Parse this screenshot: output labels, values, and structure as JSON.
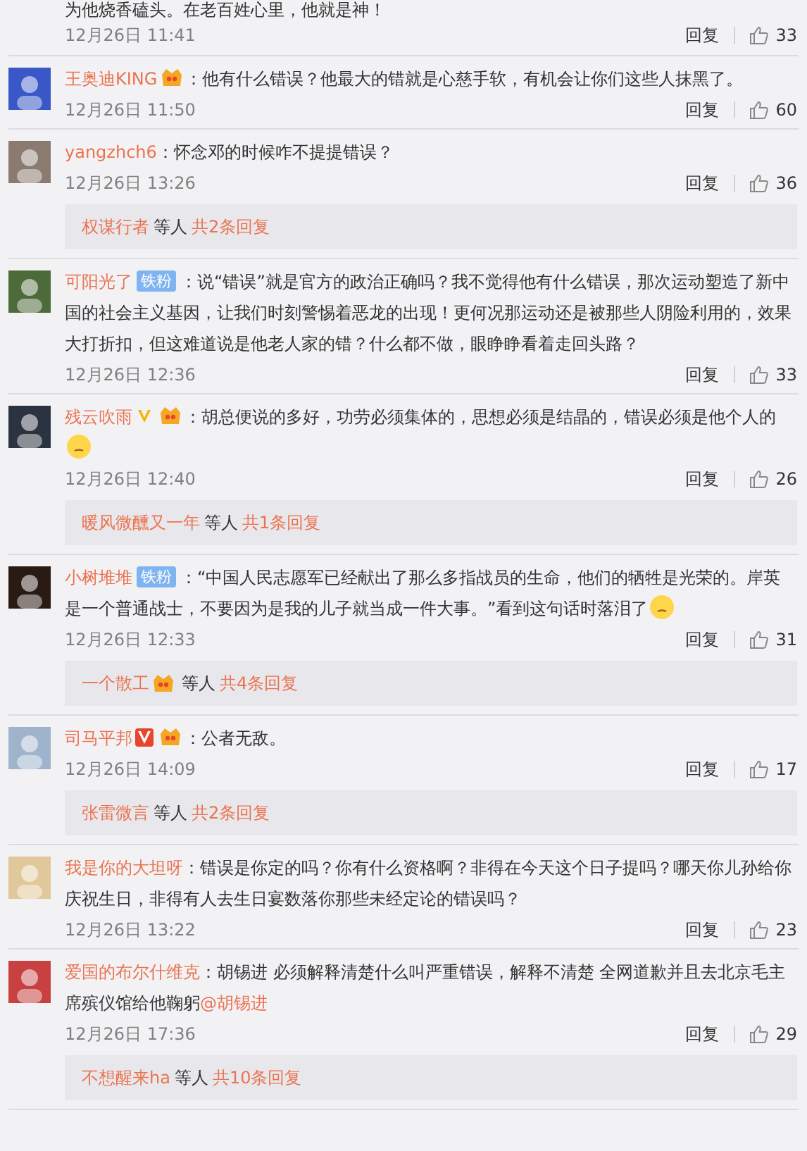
{
  "top_comment": {
    "text": "为他烧香磕头。在老百姓心里，他就是神！",
    "time": "12月26日 11:41",
    "reply": "回复",
    "likes": "33"
  },
  "comments": [
    {
      "user": "王奥迪KING",
      "badges": [
        {
          "kind": "crown"
        }
      ],
      "body": [
        {
          "kind": "text",
          "text": "：他有什么错误？他最大的错就是心慈手软，有机会让你们这些人抹黑了。"
        }
      ],
      "time": "12月26日 11:50",
      "reply": "回复",
      "likes": "60"
    },
    {
      "user": "yangzhch6",
      "body": [
        {
          "kind": "text",
          "text": "：怀念邓的时候咋不提提错误？"
        }
      ],
      "time": "12月26日 13:26",
      "reply": "回复",
      "likes": "36",
      "replies": {
        "name": "权谋行者",
        "others": "等人",
        "count": "共2条回复"
      }
    },
    {
      "user": "可阳光了",
      "badges": [
        {
          "kind": "fan",
          "text": "铁粉"
        }
      ],
      "body": [
        {
          "kind": "text",
          "text": "：说“错误”就是官方的政治正确吗？我不觉得他有什么错误，那次运动塑造了新中国的社会主义基因，让我们时刻警惕着恶龙的出现！更何况那运动还是被那些人阴险利用的，效果大打折扣，但这难道说是他老人家的错？什么都不做，眼睁睁看着走回头路？"
        }
      ],
      "time": "12月26日 12:36",
      "reply": "回复",
      "likes": "33"
    },
    {
      "user": "残云吹雨",
      "badges": [
        {
          "kind": "v_gold"
        },
        {
          "kind": "crown"
        }
      ],
      "body": [
        {
          "kind": "text",
          "text": "：胡总便说的多好，功劳必须集体的，思想必须是结晶的，错误必须是他个人的"
        },
        {
          "kind": "emoji"
        }
      ],
      "time": "12月26日 12:40",
      "reply": "回复",
      "likes": "26",
      "replies": {
        "name": "暖风微醺又一年",
        "others": "等人",
        "count": "共1条回复"
      }
    },
    {
      "user": "小树堆堆",
      "badges": [
        {
          "kind": "fan",
          "text": "铁粉"
        }
      ],
      "body": [
        {
          "kind": "text",
          "text": "：“中国人民志愿军已经献出了那么多指战员的生命，他们的牺牲是光荣的。岸英是一个普通战士，不要因为是我的儿子就当成一件大事。”看到这句话时落泪了"
        },
        {
          "kind": "emoji"
        }
      ],
      "time": "12月26日 12:33",
      "reply": "回复",
      "likes": "31",
      "replies": {
        "name": "一个散工",
        "badges": [
          {
            "kind": "crown"
          }
        ],
        "others": "等人",
        "count": "共4条回复"
      }
    },
    {
      "user": "司马平邦",
      "badges": [
        {
          "kind": "v_red"
        },
        {
          "kind": "crown"
        }
      ],
      "body": [
        {
          "kind": "text",
          "text": "：公者无敌。"
        }
      ],
      "time": "12月26日 14:09",
      "reply": "回复",
      "likes": "17",
      "replies": {
        "name": "张雷微言",
        "others": "等人",
        "count": "共2条回复"
      }
    },
    {
      "user": "我是你的大坦呀",
      "body": [
        {
          "kind": "text",
          "text": "：错误是你定的吗？你有什么资格啊？非得在今天这个日子提吗？哪天你儿孙给你庆祝生日，非得有人去生日宴数落你那些未经定论的错误吗？"
        }
      ],
      "time": "12月26日 13:22",
      "reply": "回复",
      "likes": "23"
    },
    {
      "user": "爱国的布尔什维克",
      "body": [
        {
          "kind": "text",
          "text": "：胡锡进 必须解释清楚什么叫严重错误，解释不清楚 全网道歉并且去北京毛主席殡仪馆给他鞠躬"
        },
        {
          "kind": "mention",
          "text": "@胡锡进"
        }
      ],
      "time": "12月26日 17:36",
      "reply": "回复",
      "likes": "29",
      "replies": {
        "name": "不想醒来ha",
        "others": "等人",
        "count": "共10条回复"
      }
    }
  ]
}
